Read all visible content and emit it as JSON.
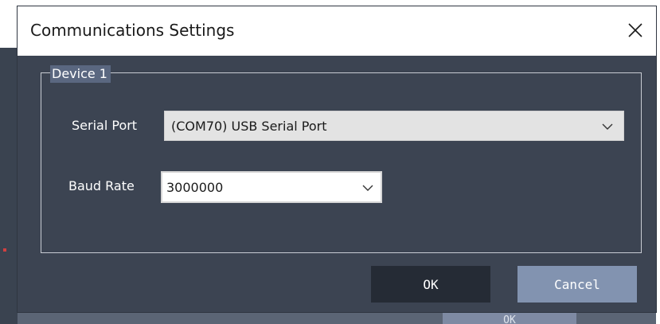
{
  "dialog": {
    "title": "Communications Settings",
    "group_label": "Device 1",
    "serial_port": {
      "label": "Serial Port",
      "value": "(COM70) USB Serial Port"
    },
    "baud_rate": {
      "label": "Baud Rate",
      "value": "3000000"
    },
    "ok_label": "OK",
    "cancel_label": "Cancel"
  },
  "background": {
    "ok_label": "OK"
  },
  "icons": {
    "close": "close-icon",
    "dropdown": "chevron-down-icon"
  },
  "colors": {
    "dialog_bg": "#3c4452",
    "ok_bg": "#252b35",
    "cancel_bg": "#8293b0",
    "group_label_bg": "#5a6780"
  }
}
